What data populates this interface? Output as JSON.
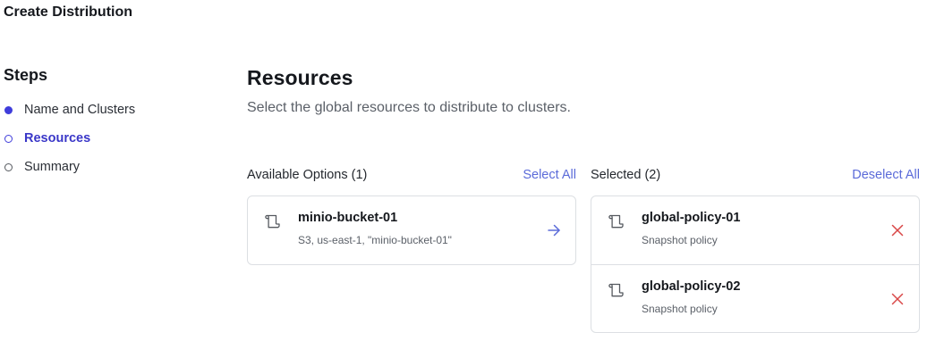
{
  "header": {
    "title": "Create Distribution"
  },
  "steps": {
    "title": "Steps",
    "items": [
      {
        "label": "Name and Clusters",
        "state": "done"
      },
      {
        "label": "Resources",
        "state": "active"
      },
      {
        "label": "Summary",
        "state": "pending"
      }
    ]
  },
  "section": {
    "title": "Resources",
    "description": "Select the global resources to distribute to clusters."
  },
  "available": {
    "title": "Available Options (1)",
    "select_all_label": "Select All",
    "items": [
      {
        "name": "minio-bucket-01",
        "detail": "S3, us-east-1, \"minio-bucket-01\"",
        "icon": "scroll-icon",
        "action_icon": "arrow-right-icon"
      }
    ]
  },
  "selected": {
    "title": "Selected (2)",
    "deselect_all_label": "Deselect All",
    "items": [
      {
        "name": "global-policy-01",
        "detail": "Snapshot policy",
        "icon": "scroll-icon",
        "action_icon": "close-icon"
      },
      {
        "name": "global-policy-02",
        "detail": "Snapshot policy",
        "icon": "scroll-icon",
        "action_icon": "close-icon"
      }
    ]
  },
  "colors": {
    "accent": "#3f3ddb",
    "link": "#5b6bd9",
    "remove": "#d94848",
    "border": "#dcdfe3"
  }
}
